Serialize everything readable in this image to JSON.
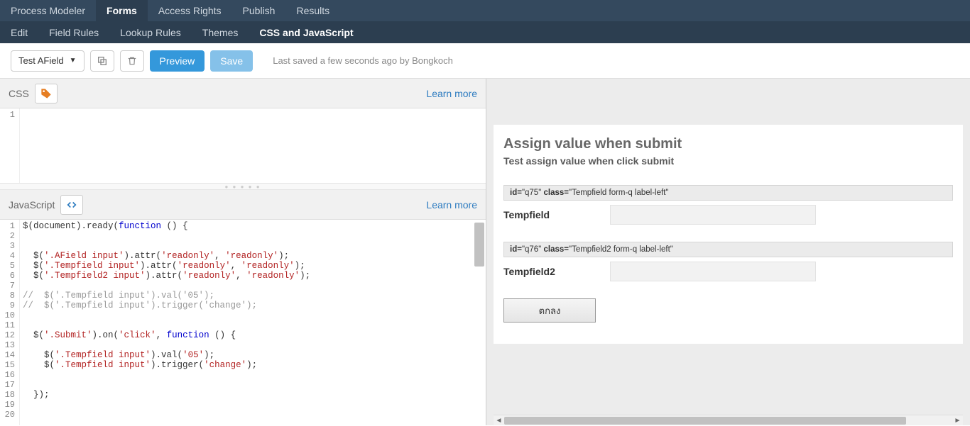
{
  "top_nav": {
    "items": [
      {
        "label": "Process Modeler"
      },
      {
        "label": "Forms"
      },
      {
        "label": "Access Rights"
      },
      {
        "label": "Publish"
      },
      {
        "label": "Results"
      }
    ],
    "active_index": 1
  },
  "sub_nav": {
    "items": [
      {
        "label": "Edit"
      },
      {
        "label": "Field Rules"
      },
      {
        "label": "Lookup Rules"
      },
      {
        "label": "Themes"
      },
      {
        "label": "CSS and JavaScript"
      }
    ],
    "active_index": 4
  },
  "toolbar": {
    "dropdown_label": "Test AField",
    "preview_label": "Preview",
    "save_label": "Save",
    "saved_text": "Last saved a few seconds ago by Bongkoch"
  },
  "css_section": {
    "title": "CSS",
    "learn_more": "Learn more",
    "lines": [
      "1"
    ]
  },
  "js_section": {
    "title": "JavaScript",
    "learn_more": "Learn more",
    "lines": [
      "1",
      "2",
      "3",
      "4",
      "5",
      "6",
      "7",
      "8",
      "9",
      "10",
      "11",
      "12",
      "13",
      "14",
      "15",
      "16",
      "17",
      "18",
      "19",
      "20"
    ],
    "code": {
      "l1_a": "$(document).ready(",
      "l1_b": "function",
      "l1_c": " () {",
      "l4_a": "  $(",
      "l4_b": "'.AField input'",
      "l4_c": ").attr(",
      "l4_d": "'readonly'",
      "l4_e": ", ",
      "l4_f": "'readonly'",
      "l4_g": ");",
      "l5_a": "  $(",
      "l5_b": "'.Tempfield input'",
      "l5_c": ").attr(",
      "l5_d": "'readonly'",
      "l5_e": ", ",
      "l5_f": "'readonly'",
      "l5_g": ");",
      "l6_a": "  $(",
      "l6_b": "'.Tempfield2 input'",
      "l6_c": ").attr(",
      "l6_d": "'readonly'",
      "l6_e": ", ",
      "l6_f": "'readonly'",
      "l6_g": ");",
      "l8": "//  $('.Tempfield input').val('05');",
      "l9": "//  $('.Tempfield input').trigger('change');",
      "l12_a": "  $(",
      "l12_b": "'.Submit'",
      "l12_c": ").on(",
      "l12_d": "'click'",
      "l12_e": ", ",
      "l12_f": "function",
      "l12_g": " () {",
      "l14_a": "    $(",
      "l14_b": "'.Tempfield input'",
      "l14_c": ").val(",
      "l14_d": "'05'",
      "l14_e": ");",
      "l15_a": "    $(",
      "l15_b": "'.Tempfield input'",
      "l15_c": ").trigger(",
      "l15_d": "'change'",
      "l15_e": ");",
      "l18": "  });"
    }
  },
  "preview": {
    "title": "Assign value when submit",
    "subtitle": "Test assign value when click submit",
    "field1": {
      "meta_id_k": "id=",
      "meta_id_v": "\"q75\"",
      "meta_class_k": " class=",
      "meta_class_v": "\"Tempfield form-q label-left\"",
      "label": "Tempfield"
    },
    "field2": {
      "meta_id_k": "id=",
      "meta_id_v": "\"q76\"",
      "meta_class_k": " class=",
      "meta_class_v": "\"Tempfield2 form-q label-left\"",
      "label": "Tempfield2"
    },
    "submit_label": "ตกลง"
  }
}
